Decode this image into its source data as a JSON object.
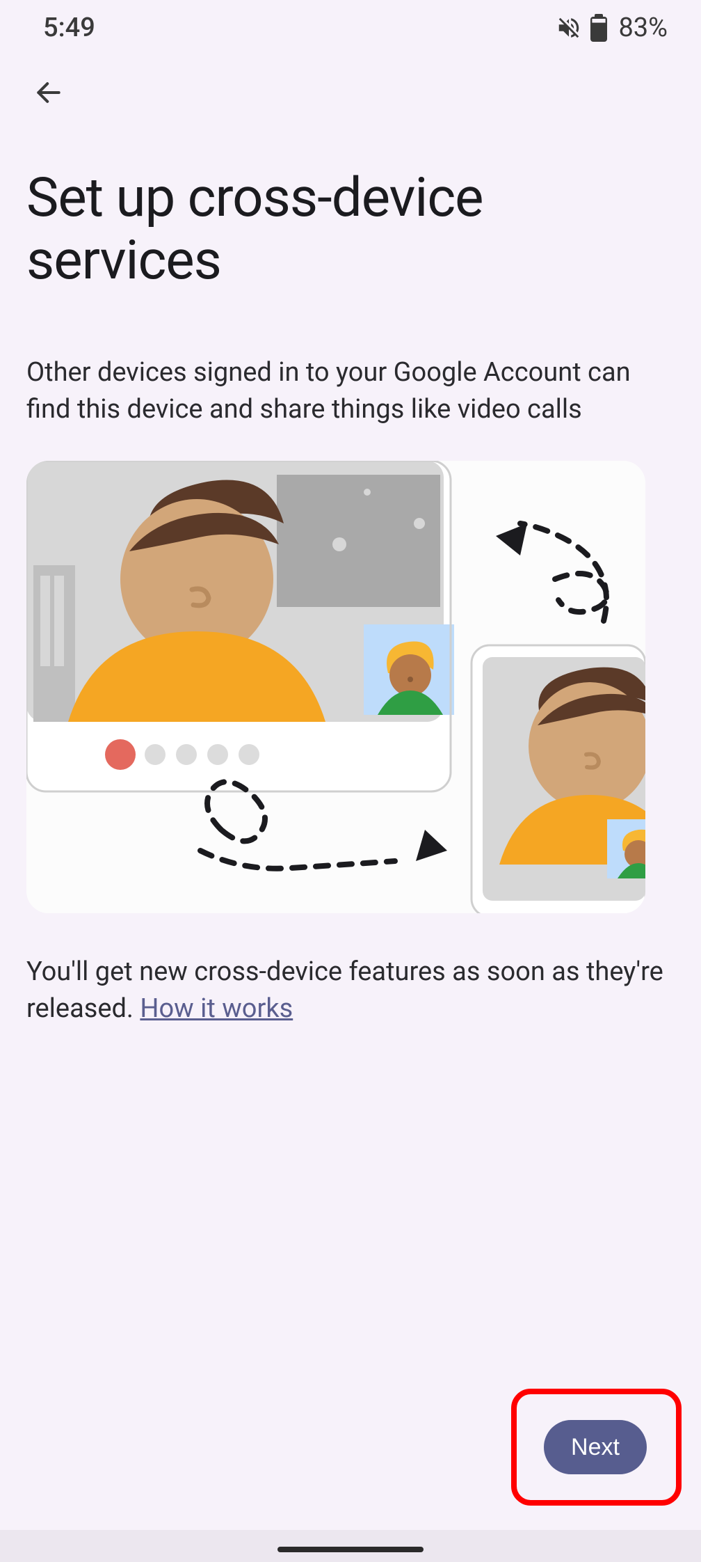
{
  "status": {
    "time": "5:49",
    "battery": "83%"
  },
  "page": {
    "title": "Set up cross-device services",
    "subtitle": "Other devices signed in to your Google Account can find this device and share things like video calls",
    "footnote_pre": "You'll get new cross-device features as soon as they're released. ",
    "footnote_link": "How it works"
  },
  "actions": {
    "next": "Next"
  }
}
